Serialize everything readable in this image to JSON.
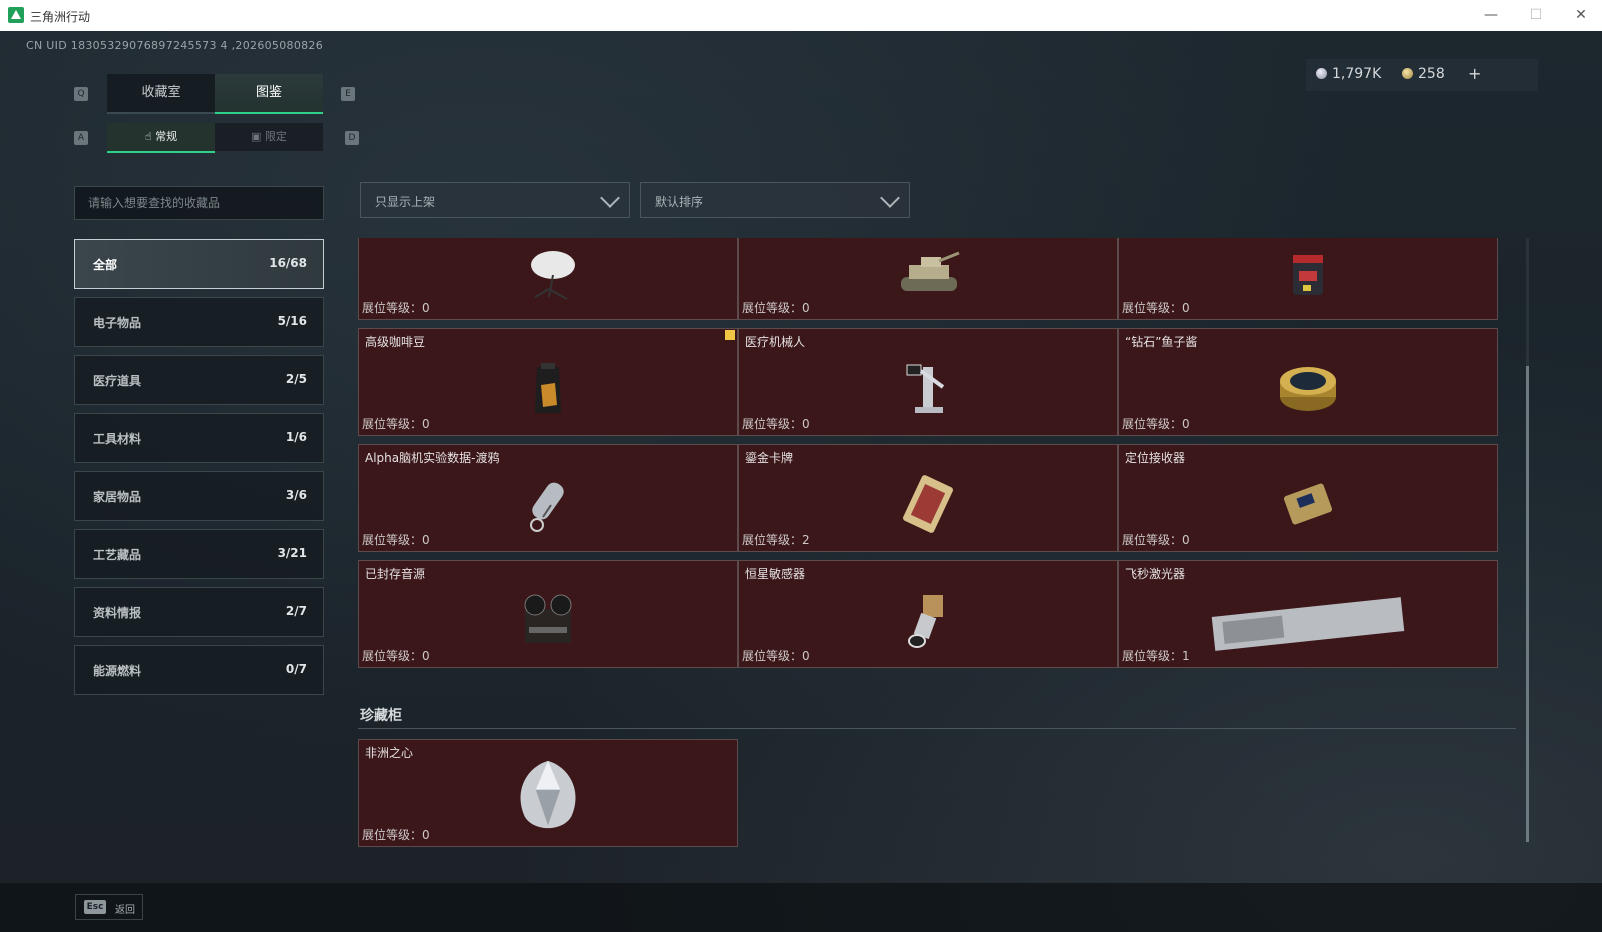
{
  "window": {
    "title": "三角洲行动",
    "minimize": "—",
    "maximize": "☐",
    "close": "✕"
  },
  "uid": "CN UID 18305329076897245573 4 ,202605080826",
  "currency": {
    "silver": "1,797K",
    "gold": "258",
    "add": "+"
  },
  "keyhints": {
    "q": "Q",
    "e": "E",
    "a": "A",
    "d": "D"
  },
  "tabs": [
    {
      "label": "收藏室"
    },
    {
      "label": "图鉴"
    }
  ],
  "subtabs": [
    {
      "label": "常规"
    },
    {
      "label": "限定"
    }
  ],
  "search": {
    "placeholder": "请输入想要查找的收藏品"
  },
  "filters": {
    "shelf": "只显示上架",
    "sort": "默认排序"
  },
  "categories": [
    {
      "name": "全部",
      "count": "16/68"
    },
    {
      "name": "电子物品",
      "count": "5/16"
    },
    {
      "name": "医疗道具",
      "count": "2/5"
    },
    {
      "name": "工具材料",
      "count": "1/6"
    },
    {
      "name": "家居物品",
      "count": "3/6"
    },
    {
      "name": "工艺藏品",
      "count": "3/21"
    },
    {
      "name": "资料情报",
      "count": "2/7"
    },
    {
      "name": "能源燃料",
      "count": "0/7"
    }
  ],
  "items": [
    {
      "name": "",
      "level_label": "展位等级：",
      "level": "0",
      "icon": "satellite-dish-icon"
    },
    {
      "name": "",
      "level_label": "展位等级：",
      "level": "0",
      "icon": "tank-model-icon"
    },
    {
      "name": "",
      "level_label": "展位等级：",
      "level": "0",
      "icon": "red-device-icon"
    },
    {
      "name": "高级咖啡豆",
      "level_label": "展位等级：",
      "level": "0",
      "icon": "coffee-bag-icon"
    },
    {
      "name": "医疗机械人",
      "level_label": "展位等级：",
      "level": "0",
      "icon": "medical-robot-icon"
    },
    {
      "name": "“钻石”鱼子酱",
      "level_label": "展位等级：",
      "level": "0",
      "icon": "caviar-tin-icon"
    },
    {
      "name": "Alpha脑机实验数据-渡鸦",
      "level_label": "展位等级：",
      "level": "0",
      "icon": "data-capsule-icon"
    },
    {
      "name": "鎏金卡牌",
      "level_label": "展位等级：",
      "level": "2",
      "icon": "gilded-card-icon"
    },
    {
      "name": "定位接收器",
      "level_label": "展位等级：",
      "level": "0",
      "icon": "receiver-icon"
    },
    {
      "name": "已封存音源",
      "level_label": "展位等级：",
      "level": "0",
      "icon": "tape-recorder-icon"
    },
    {
      "name": "恒星敏感器",
      "level_label": "展位等级：",
      "level": "0",
      "icon": "star-sensor-icon"
    },
    {
      "name": "飞秒激光器",
      "level_label": "展位等级：",
      "level": "1",
      "icon": "laser-device-icon"
    }
  ],
  "treasure": {
    "title": "珍藏柜",
    "items": [
      {
        "name": "非洲之心",
        "level_label": "展位等级：",
        "level": "0",
        "icon": "diamond-icon"
      }
    ]
  },
  "footer": {
    "key": "Esc",
    "label": "返回"
  },
  "colors": {
    "accent": "#2fd08a",
    "card_bg": "#3b1719",
    "badge": "#f1c644"
  }
}
